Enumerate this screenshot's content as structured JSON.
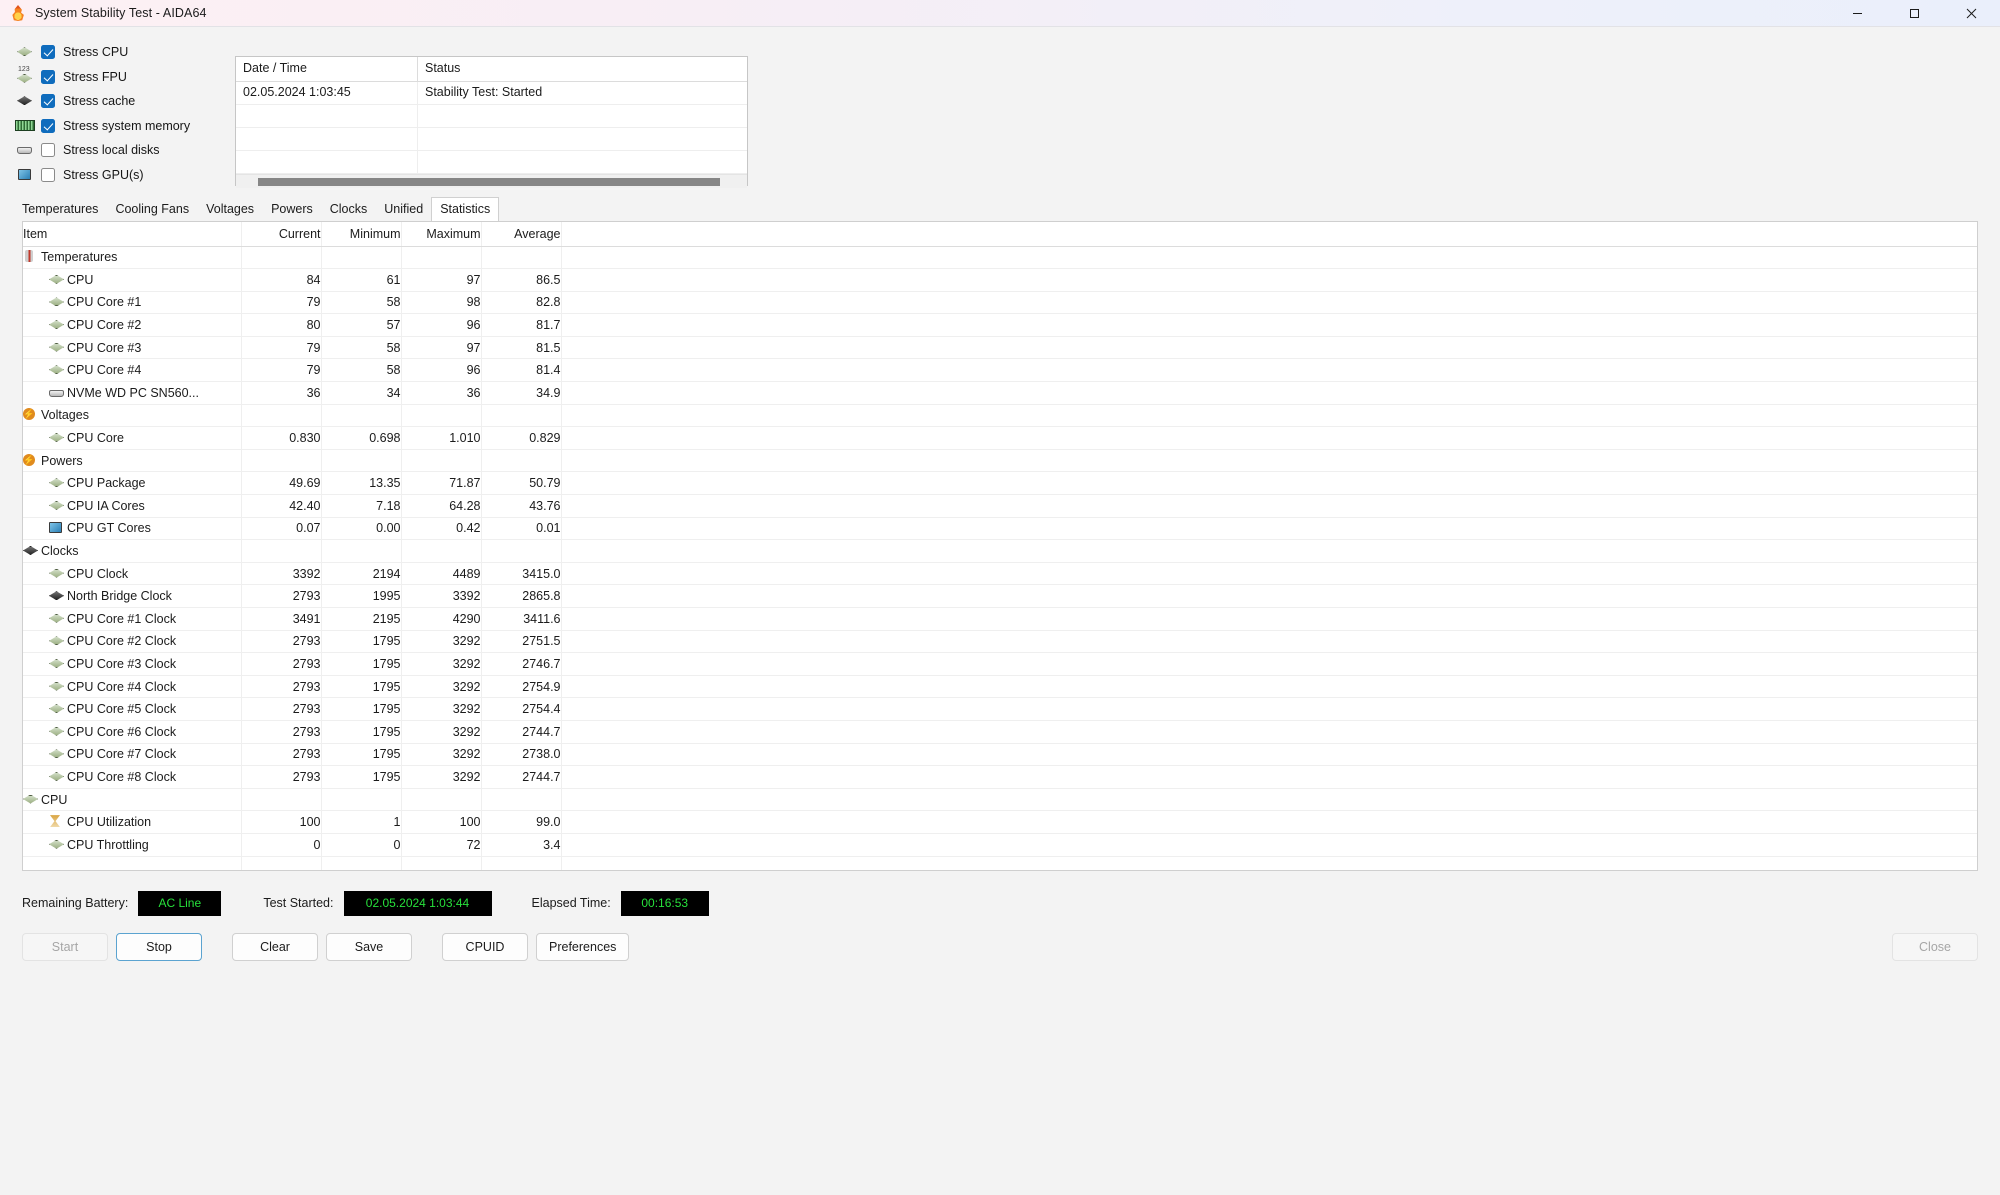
{
  "window": {
    "title": "System Stability Test - AIDA64",
    "app_icon": "flame-icon",
    "minimize": "minimize-icon",
    "maximize": "maximize-icon",
    "close": "close-icon"
  },
  "stress_options": [
    {
      "label": "Stress CPU",
      "checked": true,
      "icon": "cpu-chip-icon"
    },
    {
      "label": "Stress FPU",
      "checked": true,
      "icon": "fpu-chip-icon"
    },
    {
      "label": "Stress cache",
      "checked": true,
      "icon": "cache-chip-icon"
    },
    {
      "label": "Stress system memory",
      "checked": true,
      "icon": "memory-module-icon"
    },
    {
      "label": "Stress local disks",
      "checked": false,
      "icon": "disk-icon"
    },
    {
      "label": "Stress GPU(s)",
      "checked": false,
      "icon": "gpu-icon"
    }
  ],
  "log": {
    "headers": {
      "date_time": "Date / Time",
      "status": "Status"
    },
    "rows": [
      {
        "date_time": "02.05.2024 1:03:45",
        "status": "Stability Test: Started"
      }
    ],
    "empty_rows": 3
  },
  "tabs": [
    {
      "label": "Temperatures",
      "active": false
    },
    {
      "label": "Cooling Fans",
      "active": false
    },
    {
      "label": "Voltages",
      "active": false
    },
    {
      "label": "Powers",
      "active": false
    },
    {
      "label": "Clocks",
      "active": false
    },
    {
      "label": "Unified",
      "active": false
    },
    {
      "label": "Statistics",
      "active": true
    }
  ],
  "table": {
    "headers": [
      "Item",
      "Current",
      "Minimum",
      "Maximum",
      "Average"
    ],
    "rows": [
      {
        "type": "group",
        "icon": "thermometer-icon",
        "item": "Temperatures",
        "current": "",
        "minimum": "",
        "maximum": "",
        "average": ""
      },
      {
        "type": "item",
        "icon": "chip-icon",
        "item": "CPU",
        "current": "84",
        "minimum": "61",
        "maximum": "97",
        "average": "86.5"
      },
      {
        "type": "item",
        "icon": "chip-icon",
        "item": "CPU Core #1",
        "current": "79",
        "minimum": "58",
        "maximum": "98",
        "average": "82.8"
      },
      {
        "type": "item",
        "icon": "chip-icon",
        "item": "CPU Core #2",
        "current": "80",
        "minimum": "57",
        "maximum": "96",
        "average": "81.7"
      },
      {
        "type": "item",
        "icon": "chip-icon",
        "item": "CPU Core #3",
        "current": "79",
        "minimum": "58",
        "maximum": "97",
        "average": "81.5"
      },
      {
        "type": "item",
        "icon": "chip-icon",
        "item": "CPU Core #4",
        "current": "79",
        "minimum": "58",
        "maximum": "96",
        "average": "81.4"
      },
      {
        "type": "item",
        "icon": "disk-icon",
        "item": "NVMe WD PC SN560...",
        "current": "36",
        "minimum": "34",
        "maximum": "36",
        "average": "34.9"
      },
      {
        "type": "group",
        "icon": "bolt-icon",
        "item": "Voltages",
        "current": "",
        "minimum": "",
        "maximum": "",
        "average": ""
      },
      {
        "type": "item",
        "icon": "chip-icon",
        "item": "CPU Core",
        "current": "0.830",
        "minimum": "0.698",
        "maximum": "1.010",
        "average": "0.829"
      },
      {
        "type": "group",
        "icon": "bolt-icon",
        "item": "Powers",
        "current": "",
        "minimum": "",
        "maximum": "",
        "average": ""
      },
      {
        "type": "item",
        "icon": "chip-icon",
        "item": "CPU Package",
        "current": "49.69",
        "minimum": "13.35",
        "maximum": "71.87",
        "average": "50.79"
      },
      {
        "type": "item",
        "icon": "chip-icon",
        "item": "CPU IA Cores",
        "current": "42.40",
        "minimum": "7.18",
        "maximum": "64.28",
        "average": "43.76"
      },
      {
        "type": "item",
        "icon": "gpu-icon",
        "item": "CPU GT Cores",
        "current": "0.07",
        "minimum": "0.00",
        "maximum": "0.42",
        "average": "0.01"
      },
      {
        "type": "group",
        "icon": "chip-dark-icon",
        "item": "Clocks",
        "current": "",
        "minimum": "",
        "maximum": "",
        "average": ""
      },
      {
        "type": "item",
        "icon": "chip-icon",
        "item": "CPU Clock",
        "current": "3392",
        "minimum": "2194",
        "maximum": "4489",
        "average": "3415.0"
      },
      {
        "type": "item",
        "icon": "chip-dark-icon",
        "item": "North Bridge Clock",
        "current": "2793",
        "minimum": "1995",
        "maximum": "3392",
        "average": "2865.8"
      },
      {
        "type": "item",
        "icon": "chip-icon",
        "item": "CPU Core #1 Clock",
        "current": "3491",
        "minimum": "2195",
        "maximum": "4290",
        "average": "3411.6"
      },
      {
        "type": "item",
        "icon": "chip-icon",
        "item": "CPU Core #2 Clock",
        "current": "2793",
        "minimum": "1795",
        "maximum": "3292",
        "average": "2751.5"
      },
      {
        "type": "item",
        "icon": "chip-icon",
        "item": "CPU Core #3 Clock",
        "current": "2793",
        "minimum": "1795",
        "maximum": "3292",
        "average": "2746.7"
      },
      {
        "type": "item",
        "icon": "chip-icon",
        "item": "CPU Core #4 Clock",
        "current": "2793",
        "minimum": "1795",
        "maximum": "3292",
        "average": "2754.9"
      },
      {
        "type": "item",
        "icon": "chip-icon",
        "item": "CPU Core #5 Clock",
        "current": "2793",
        "minimum": "1795",
        "maximum": "3292",
        "average": "2754.4"
      },
      {
        "type": "item",
        "icon": "chip-icon",
        "item": "CPU Core #6 Clock",
        "current": "2793",
        "minimum": "1795",
        "maximum": "3292",
        "average": "2744.7"
      },
      {
        "type": "item",
        "icon": "chip-icon",
        "item": "CPU Core #7 Clock",
        "current": "2793",
        "minimum": "1795",
        "maximum": "3292",
        "average": "2738.0"
      },
      {
        "type": "item",
        "icon": "chip-icon",
        "item": "CPU Core #8 Clock",
        "current": "2793",
        "minimum": "1795",
        "maximum": "3292",
        "average": "2744.7"
      },
      {
        "type": "group",
        "icon": "chip-icon",
        "item": "CPU",
        "current": "",
        "minimum": "",
        "maximum": "",
        "average": ""
      },
      {
        "type": "item",
        "icon": "hourglass-icon",
        "item": "CPU Utilization",
        "current": "100",
        "minimum": "1",
        "maximum": "100",
        "average": "99.0"
      },
      {
        "type": "item",
        "icon": "chip-icon",
        "item": "CPU Throttling",
        "current": "0",
        "minimum": "0",
        "maximum": "72",
        "average": "3.4"
      }
    ],
    "empty_row_count": 7
  },
  "status": {
    "battery_label": "Remaining Battery:",
    "battery_value": "AC Line",
    "started_label": "Test Started:",
    "started_value": "02.05.2024 1:03:44",
    "elapsed_label": "Elapsed Time:",
    "elapsed_value": "00:16:53",
    "lcd_color": "#27e03b",
    "lcd_background": "#000000"
  },
  "buttons": {
    "start": "Start",
    "stop": "Stop",
    "clear": "Clear",
    "save": "Save",
    "cpuid": "CPUID",
    "preferences": "Preferences",
    "close": "Close"
  }
}
